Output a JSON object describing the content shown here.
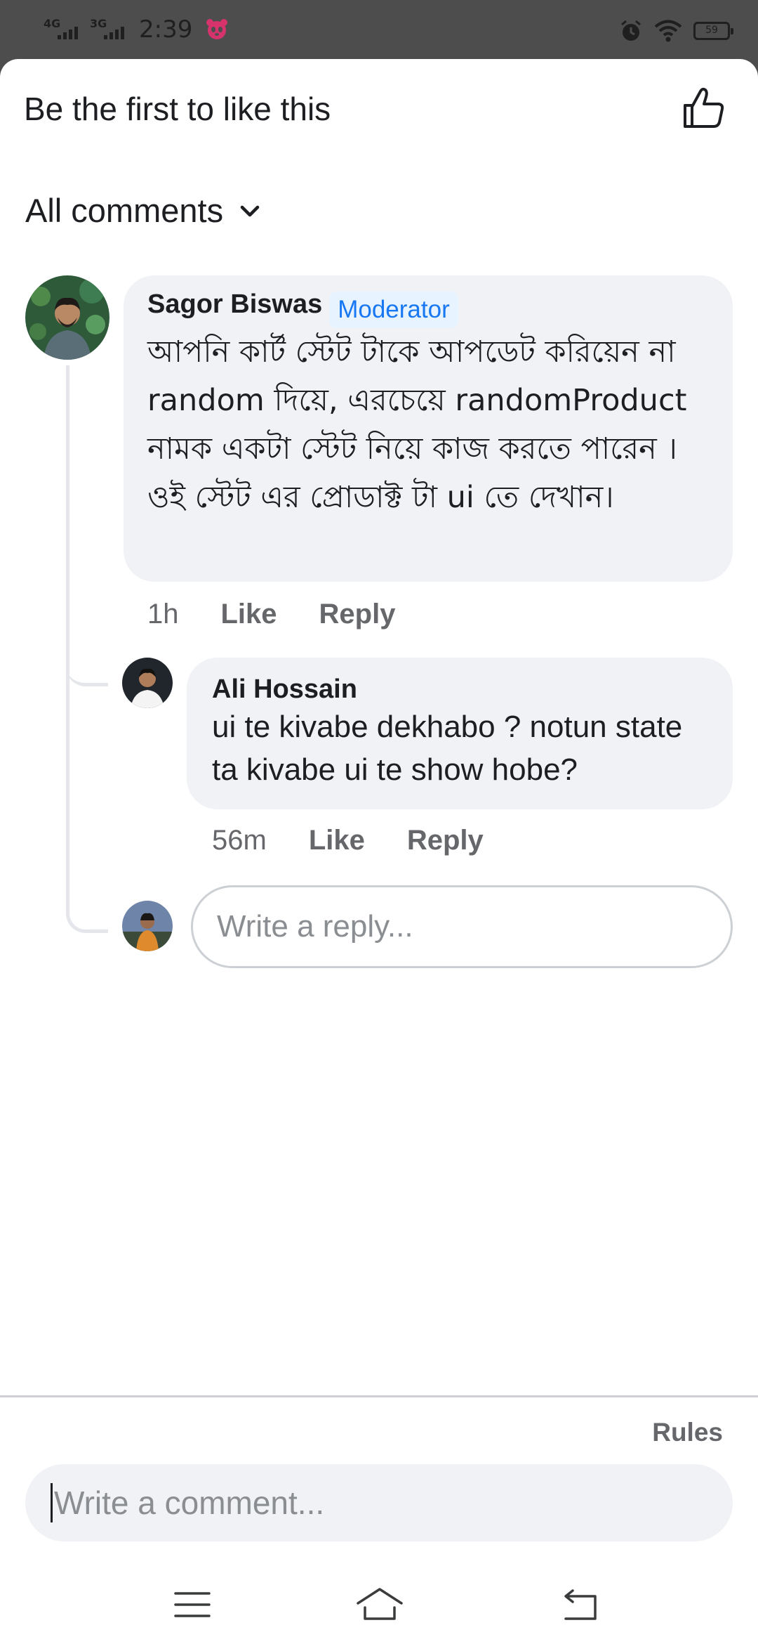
{
  "status_bar": {
    "network1": "4G",
    "network2": "3G",
    "time": "2:39",
    "battery": "59"
  },
  "header": {
    "like_text": "Be the first to like this",
    "like_icon": "thumbs-up-icon"
  },
  "sort": {
    "label": "All comments",
    "icon": "chevron-down-icon"
  },
  "comments": [
    {
      "author": "Sagor Biswas",
      "badge": "Moderator",
      "text": "আপনি কার্ট স্টেট টাকে আপডেট করিয়েন না random দিয়ে, এরচেয়ে randomProduct নামক একটা স্টেট নিয়ে কাজ করতে পারেন । ওই স্টেট এর প্রোডাক্ট টা ui তে দেখান।",
      "time": "1h",
      "like": "Like",
      "reply": "Reply"
    },
    {
      "author": "Ali Hossain",
      "text": "ui te kivabe dekhabo ? notun state ta kivabe ui te show  hobe?",
      "time": "56m",
      "like": "Like",
      "reply": "Reply"
    }
  ],
  "reply_box": {
    "placeholder": "Write a reply..."
  },
  "footer": {
    "rules": "Rules",
    "comment_placeholder": "Write a comment..."
  },
  "nav_icons": [
    "menu-icon",
    "home-icon",
    "back-icon"
  ],
  "colors": {
    "accent": "#1877f2",
    "bubble": "#f0f2f5",
    "secondary_text": "#65676b"
  }
}
